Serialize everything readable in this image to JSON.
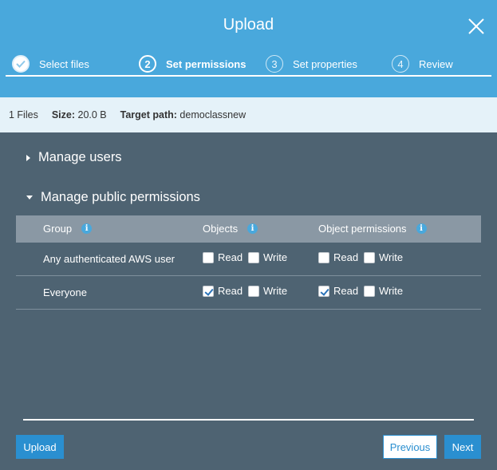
{
  "modal": {
    "title": "Upload",
    "steps": [
      {
        "number": "1",
        "label": "Select files",
        "state": "done"
      },
      {
        "number": "2",
        "label": "Set permissions",
        "state": "active"
      },
      {
        "number": "3",
        "label": "Set properties",
        "state": "inactive"
      },
      {
        "number": "4",
        "label": "Review",
        "state": "inactive"
      }
    ]
  },
  "info": {
    "files": "1 Files",
    "size_label": "Size:",
    "size_value": "20.0 B",
    "target_label": "Target path:",
    "target_value": "democlassnew"
  },
  "sections": {
    "manage_users": "Manage users",
    "manage_public": "Manage public permissions"
  },
  "table": {
    "headers": {
      "group": "Group",
      "objects": "Objects",
      "object_permissions": "Object permissions"
    },
    "info_glyph": "i",
    "rows": [
      {
        "group": "Any authenticated AWS user",
        "objects": {
          "read": {
            "label": "Read",
            "checked": false
          },
          "write": {
            "label": "Write",
            "checked": false
          }
        },
        "object_permissions": {
          "read": {
            "label": "Read",
            "checked": false
          },
          "write": {
            "label": "Write",
            "checked": false
          }
        }
      },
      {
        "group": "Everyone",
        "objects": {
          "read": {
            "label": "Read",
            "checked": true
          },
          "write": {
            "label": "Write",
            "checked": false
          }
        },
        "object_permissions": {
          "read": {
            "label": "Read",
            "checked": true
          },
          "write": {
            "label": "Write",
            "checked": false
          }
        }
      }
    ]
  },
  "buttons": {
    "upload": "Upload",
    "previous": "Previous",
    "next": "Next"
  },
  "colors": {
    "header": "#49a8dc",
    "body": "#4e6372",
    "infobar": "#e5f2f9",
    "primary": "#2a8fd0"
  }
}
